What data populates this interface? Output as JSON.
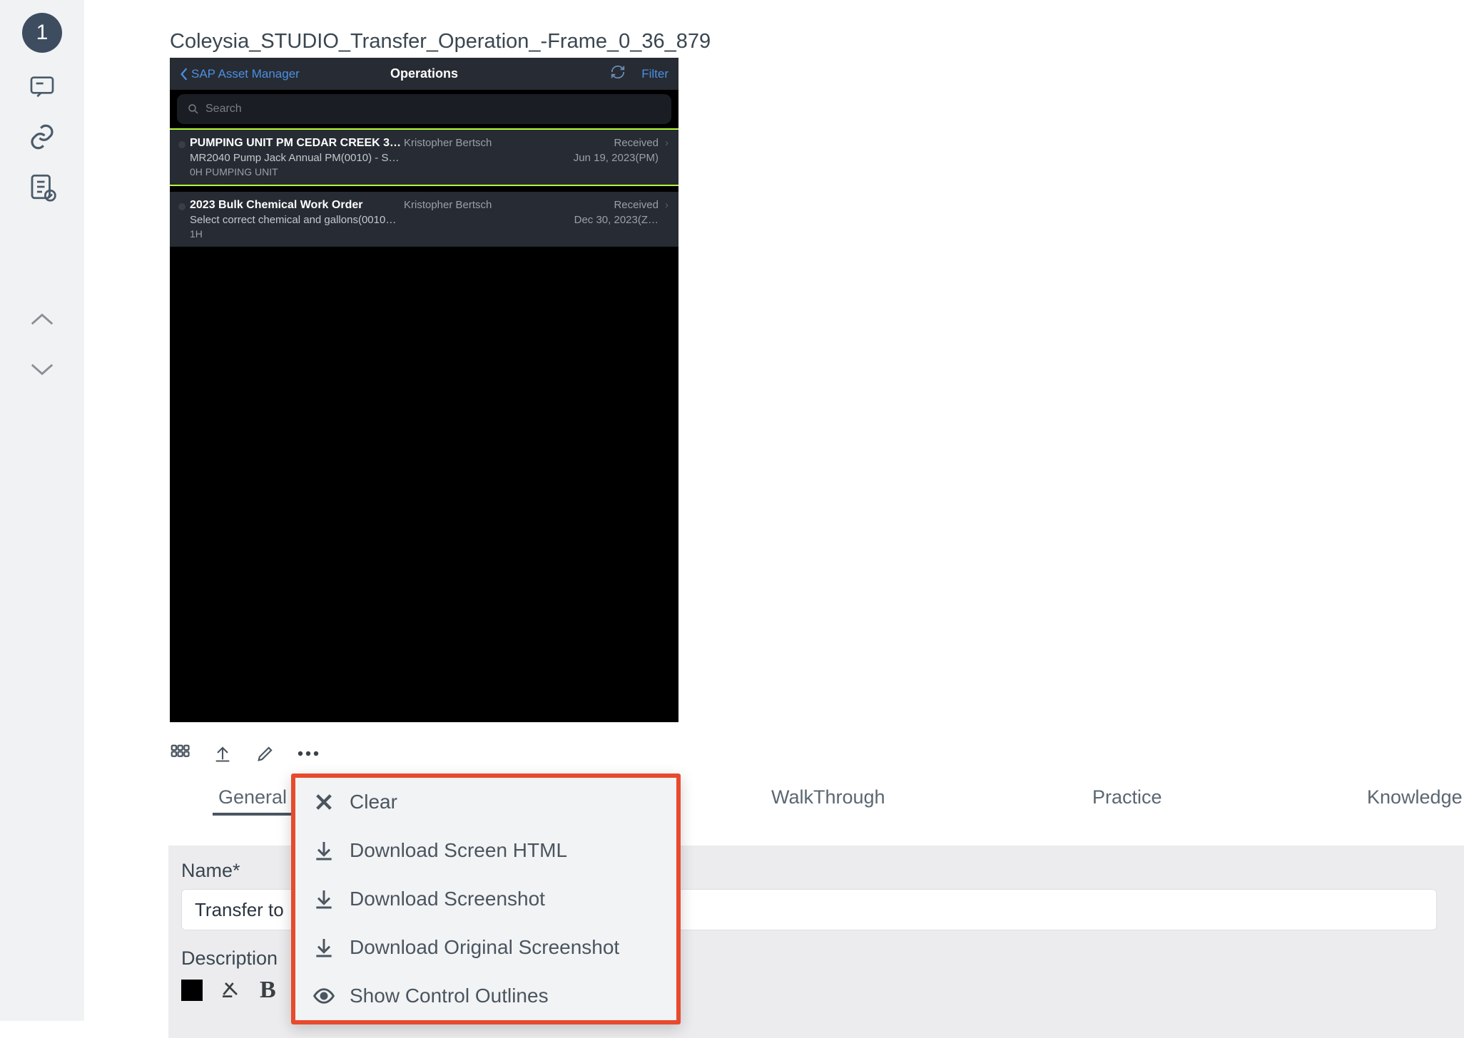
{
  "rail": {
    "badge": "1"
  },
  "page_title": "Coleysia_STUDIO_Transfer_Operation_-Frame_0_36_879",
  "preview": {
    "back_label": "SAP Asset Manager",
    "header_title": "Operations",
    "filter_label": "Filter",
    "search_placeholder": "Search",
    "ops": [
      {
        "title": "PUMPING UNIT PM CEDAR CREEK 34…",
        "person": "Kristopher Bertsch",
        "status": "Received",
        "sub": "MR2040 Pump Jack Annual PM(0010) - S…",
        "date": "Jun 19, 2023(PM)",
        "sub2": "0H PUMPING UNIT"
      },
      {
        "title": "2023 Bulk Chemical Work Order",
        "person": "Kristopher Bertsch",
        "status": "Received",
        "sub": "Select correct chemical and gallons(0010…",
        "date": "Dec 30, 2023(Z…",
        "sub2": "1H"
      }
    ]
  },
  "tabs": {
    "general": "General",
    "walkthrough": "WalkThrough",
    "practice": "Practice",
    "knowledge": "Knowledge Cl"
  },
  "form": {
    "name_label": "Name*",
    "name_value": "Transfer to",
    "desc_label": "Description",
    "bold_glyph": "B"
  },
  "dropdown": {
    "clear": "Clear",
    "dl_html": "Download Screen HTML",
    "dl_shot": "Download Screenshot",
    "dl_orig": "Download Original Screenshot",
    "show_outlines": "Show Control Outlines"
  }
}
